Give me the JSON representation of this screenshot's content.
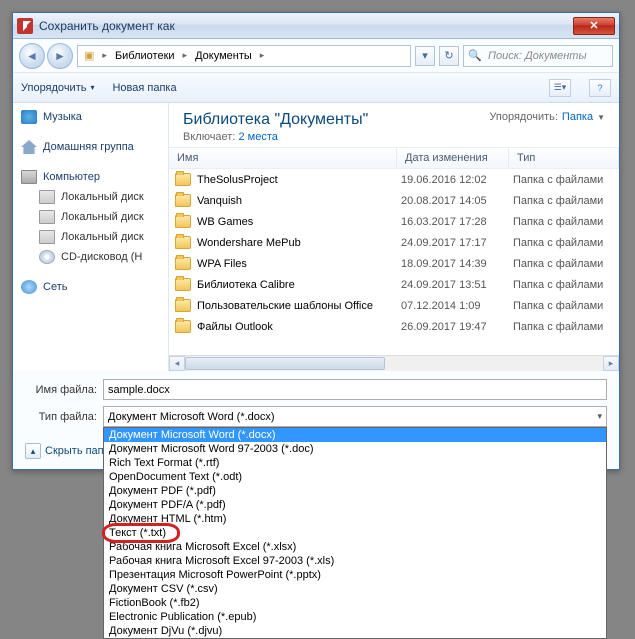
{
  "window_title": "Сохранить документ как",
  "breadcrumb": {
    "root": "Библиотеки",
    "current": "Документы"
  },
  "search_placeholder": "Поиск: Документы",
  "toolbar": {
    "organize": "Упорядочить",
    "new_folder": "Новая папка"
  },
  "sidebar": {
    "music": "Музыка",
    "homegroup": "Домашняя группа",
    "computer": "Компьютер",
    "localdisk": "Локальный диск",
    "cddrive": "CD-дисковод (H",
    "network": "Сеть"
  },
  "library": {
    "title": "Библиотека \"Документы\"",
    "includes_label": "Включает:",
    "includes_link": "2 места",
    "sort_label": "Упорядочить:",
    "sort_value": "Папка"
  },
  "columns": {
    "name": "Имя",
    "date": "Дата изменения",
    "type": "Тип"
  },
  "files": [
    {
      "name": "TheSolusProject",
      "date": "19.06.2016 12:02",
      "type": "Папка с файлами"
    },
    {
      "name": "Vanquish",
      "date": "20.08.2017 14:05",
      "type": "Папка с файлами"
    },
    {
      "name": "WB Games",
      "date": "16.03.2017 17:28",
      "type": "Папка с файлами"
    },
    {
      "name": "Wondershare MePub",
      "date": "24.09.2017 17:17",
      "type": "Папка с файлами"
    },
    {
      "name": "WPA Files",
      "date": "18.09.2017 14:39",
      "type": "Папка с файлами"
    },
    {
      "name": "Библиотека Calibre",
      "date": "24.09.2017 13:51",
      "type": "Папка с файлами"
    },
    {
      "name": "Пользовательские шаблоны Office",
      "date": "07.12.2014 1:09",
      "type": "Папка с файлами"
    },
    {
      "name": "Файлы Outlook",
      "date": "26.09.2017 19:47",
      "type": "Папка с файлами"
    }
  ],
  "filename_label": "Имя файла:",
  "filename_value": "sample.docx",
  "filetype_label": "Тип файла:",
  "filetype_selected": "Документ Microsoft Word (*.docx)",
  "filetype_options": [
    "Документ Microsoft Word (*.docx)",
    "Документ Microsoft Word 97-2003 (*.doc)",
    "Rich Text Format (*.rtf)",
    "OpenDocument Text (*.odt)",
    "Документ PDF (*.pdf)",
    "Документ PDF/A (*.pdf)",
    "Документ HTML (*.htm)",
    "Текст (*.txt)",
    "Рабочая книга Microsoft Excel (*.xlsx)",
    "Рабочая книга Microsoft Excel 97-2003 (*.xls)",
    "Презентация Microsoft PowerPoint (*.pptx)",
    "Документ CSV (*.csv)",
    "FictionBook (*.fb2)",
    "Electronic Publication (*.epub)",
    "Документ DjVu (*.djvu)"
  ],
  "hide_folders": "Скрыть папки"
}
